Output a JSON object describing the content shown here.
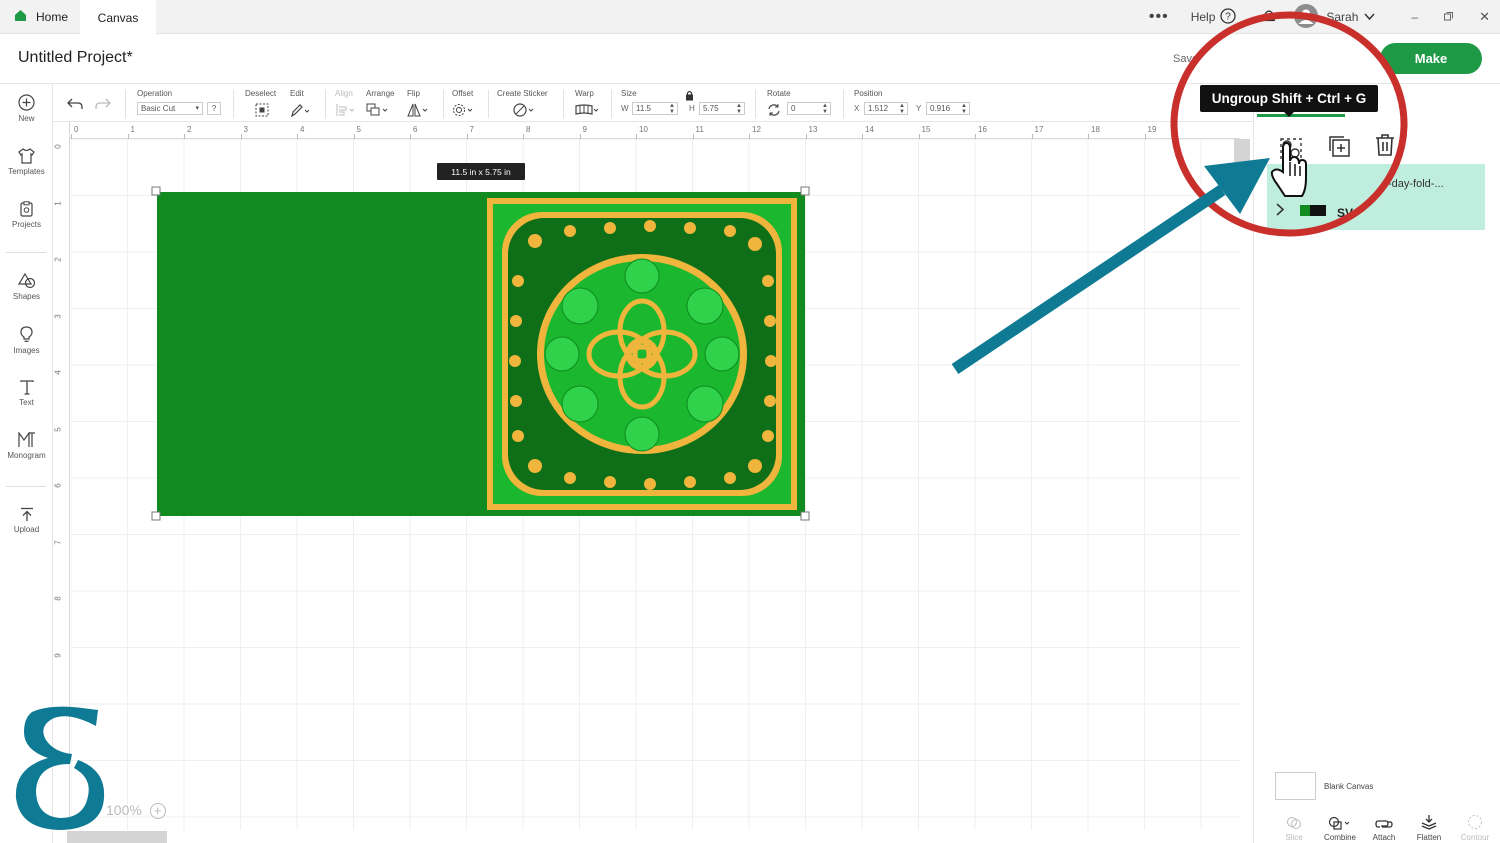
{
  "tabs": {
    "home": "Home",
    "canvas": "Canvas"
  },
  "topbar": {
    "help": "Help",
    "user": "Sarah"
  },
  "header": {
    "title": "Untitled Project*",
    "save": "Save",
    "make": "Make"
  },
  "sidebar": {
    "items": [
      {
        "label": "New",
        "icon": "plus-circle-icon"
      },
      {
        "label": "Templates",
        "icon": "shirt-icon"
      },
      {
        "label": "Projects",
        "icon": "projects-icon"
      },
      {
        "label": "Shapes",
        "icon": "shapes-icon"
      },
      {
        "label": "Images",
        "icon": "lightbulb-icon"
      },
      {
        "label": "Text",
        "icon": "text-icon"
      },
      {
        "label": "Monogram",
        "icon": "monogram-icon"
      },
      {
        "label": "Upload",
        "icon": "upload-icon"
      }
    ]
  },
  "toolbar": {
    "operation_label": "Operation",
    "operation_value": "Basic Cut",
    "deselect": "Deselect",
    "edit": "Edit",
    "align": "Align",
    "arrange": "Arrange",
    "flip": "Flip",
    "offset": "Offset",
    "create_sticker": "Create Sticker",
    "warp": "Warp",
    "size": "Size",
    "size_w_label": "W",
    "size_w": "11.5",
    "size_h_label": "H",
    "size_h": "5.75",
    "rotate": "Rotate",
    "rotate_value": "0",
    "position": "Position",
    "pos_x_label": "X",
    "pos_x": "1.512",
    "pos_y_label": "Y",
    "pos_y": "0.916"
  },
  "ruler": {
    "top": [
      "0",
      "1",
      "2",
      "3",
      "4",
      "5",
      "6",
      "7",
      "8",
      "9",
      "10",
      "11",
      "12",
      "13",
      "14",
      "15",
      "16",
      "17",
      "18",
      "19"
    ],
    "left": [
      "0",
      "1",
      "2",
      "3",
      "4",
      "5",
      "6",
      "7",
      "8",
      "9"
    ]
  },
  "canvas": {
    "size_badge": "11.5  in x 5.75  in",
    "zoom": "100%"
  },
  "tooltip": {
    "text": "Ungroup Shift + Ctrl + G"
  },
  "panel": {
    "layer_name": "-day-fold-...",
    "layer_sub": "SV",
    "blank_canvas": "Blank Canvas",
    "bottom_tools": [
      {
        "label": "Slice",
        "enabled": false
      },
      {
        "label": "Combine",
        "enabled": true
      },
      {
        "label": "Attach",
        "enabled": true
      },
      {
        "label": "Flatten",
        "enabled": true
      },
      {
        "label": "Contour",
        "enabled": false
      }
    ]
  },
  "colors": {
    "make_green": "#1e9a47",
    "card_green": "#118a1f",
    "annotation_red": "#c9302c",
    "arrow_teal": "#0f7a93"
  }
}
